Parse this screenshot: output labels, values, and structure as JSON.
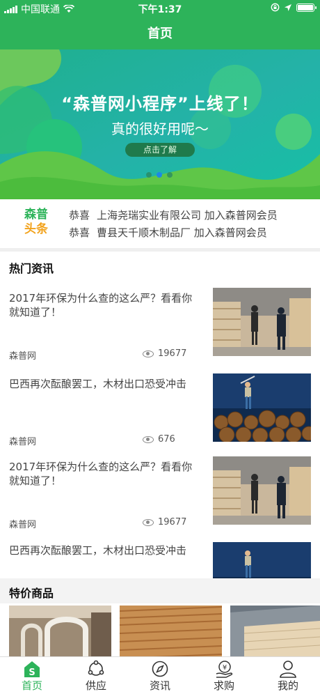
{
  "status_bar": {
    "carrier": "中国联通",
    "time": "下午1:37"
  },
  "nav": {
    "title": "首页"
  },
  "banner": {
    "title": "“森普网小程序”上线了！",
    "subtitle": "真的很好用呢～",
    "button": "点击了解",
    "page_count": 3,
    "active_page": 2
  },
  "headlines": {
    "logo_line1": "森普",
    "logo_line2": "头条",
    "items": [
      {
        "prefix": "恭喜",
        "text": "上海尧瑞实业有限公司 加入森普网会员"
      },
      {
        "prefix": "恭喜",
        "text": "曹县天千顺木制品厂 加入森普网会员"
      }
    ]
  },
  "hot_news": {
    "title": "热门资讯",
    "articles": [
      {
        "title": "2017年环保为什么查的这么严？看看你就知道了！",
        "source": "森普网",
        "views": "19677",
        "image": "warehouse-workers"
      },
      {
        "title": "巴西再次酝酿罢工，木材出口恐受冲击",
        "source": "森普网",
        "views": "676",
        "image": "lumberjack-on-logs"
      },
      {
        "title": "2017年环保为什么查的这么严？看看你就知道了！",
        "source": "森普网",
        "views": "19677",
        "image": "warehouse-workers"
      },
      {
        "title": "巴西再次酝酿罢工，木材出口恐受冲击",
        "source": "",
        "views": "",
        "image": "lumberjack-on-logs"
      }
    ]
  },
  "specials": {
    "title": "特价商品"
  },
  "tabs": [
    {
      "label": "首页",
      "icon": "home-icon",
      "active": true
    },
    {
      "label": "供应",
      "icon": "supply-icon",
      "active": false
    },
    {
      "label": "资讯",
      "icon": "compass-icon",
      "active": false
    },
    {
      "label": "求购",
      "icon": "purchase-icon",
      "active": false
    },
    {
      "label": "我的",
      "icon": "user-icon",
      "active": false
    }
  ],
  "colors": {
    "brand_green": "#2db35a",
    "accent_orange": "#f2a21b",
    "active_dot": "#1e88e5"
  }
}
